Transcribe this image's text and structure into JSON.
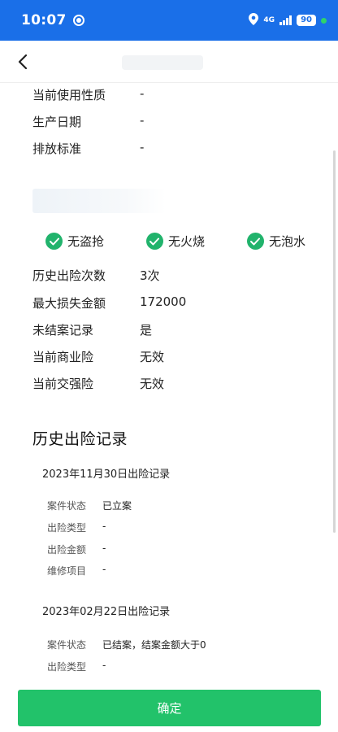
{
  "status_bar": {
    "time": "10:07",
    "network": "4G",
    "battery": "90"
  },
  "vehicle_info": {
    "rows": [
      {
        "label": "当前使用性质",
        "value": "-"
      },
      {
        "label": "生产日期",
        "value": "-"
      },
      {
        "label": "排放标准",
        "value": "-"
      }
    ]
  },
  "badges": [
    {
      "label": "无盗抢",
      "icon": "check-circle-icon"
    },
    {
      "label": "无火烧",
      "icon": "check-circle-icon"
    },
    {
      "label": "无泡水",
      "icon": "check-circle-icon"
    }
  ],
  "summary": {
    "rows": [
      {
        "label": "历史出险次数",
        "value": "3次"
      },
      {
        "label": "最大损失金额",
        "value": "172000"
      },
      {
        "label": "未结案记录",
        "value": "是"
      },
      {
        "label": "当前商业险",
        "value": "无效"
      },
      {
        "label": "当前交强险",
        "value": "无效"
      }
    ]
  },
  "history": {
    "title": "历史出险记录",
    "records": [
      {
        "title": "2023年11月30日出险记录",
        "fields": [
          {
            "label": "案件状态",
            "value": "已立案"
          },
          {
            "label": "出险类型",
            "value": "-"
          },
          {
            "label": "出险金额",
            "value": "-"
          },
          {
            "label": "维修项目",
            "value": "-"
          }
        ]
      },
      {
        "title": "2023年02月22日出险记录",
        "fields": [
          {
            "label": "案件状态",
            "value": "已结案，结案金额大于0"
          },
          {
            "label": "出险类型",
            "value": "-"
          }
        ]
      }
    ]
  },
  "footer": {
    "confirm_label": "确定"
  },
  "colors": {
    "status_bar": "#1a6fe8",
    "accent_green": "#22c26a",
    "check_green": "#21b36c"
  }
}
